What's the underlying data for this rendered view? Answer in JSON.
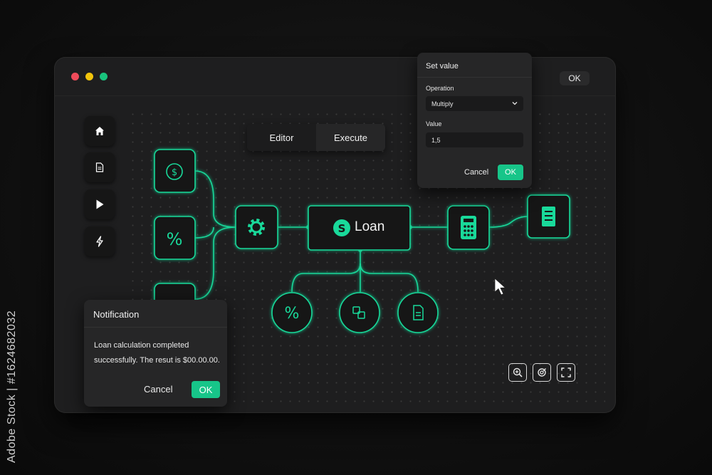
{
  "window": {
    "traffic_lights": [
      {
        "name": "close",
        "color": "#ef4b5a"
      },
      {
        "name": "minimize",
        "color": "#f2c40c"
      },
      {
        "name": "maximize",
        "color": "#19c37d"
      }
    ],
    "ok_label": "OK"
  },
  "sidebar": {
    "items": [
      {
        "name": "home",
        "icon": "home-icon"
      },
      {
        "name": "document",
        "icon": "document-icon"
      },
      {
        "name": "play",
        "icon": "play-icon"
      },
      {
        "name": "lightning",
        "icon": "lightning-icon"
      }
    ]
  },
  "tabs": [
    {
      "label": "Editor",
      "active": true
    },
    {
      "label": "Execute",
      "active": false
    }
  ],
  "flow": {
    "accent": "#19d99a",
    "center_node_label": "Loan",
    "nodes": [
      "dollar-node",
      "percent-node",
      "third-input-node",
      "gear-node",
      "loan-node",
      "calculator-node",
      "report-node",
      "percent-bottom-node",
      "copy-node",
      "document-bottom-node"
    ]
  },
  "zoom_controls": [
    "zoom-in-icon",
    "zoom-target-icon",
    "fullscreen-icon"
  ],
  "set_value": {
    "title": "Set value",
    "operation_label": "Operation",
    "operation_value": "Multiply",
    "value_label": "Value",
    "value": "1,5",
    "cancel_label": "Cancel",
    "ok_label": "OK"
  },
  "notification": {
    "title": "Notification",
    "message": "Loan calculation completed successfully. The resut is $00.00.00.",
    "cancel_label": "Cancel",
    "ok_label": "OK"
  },
  "watermark_id": "Adobe Stock | #1624682032"
}
